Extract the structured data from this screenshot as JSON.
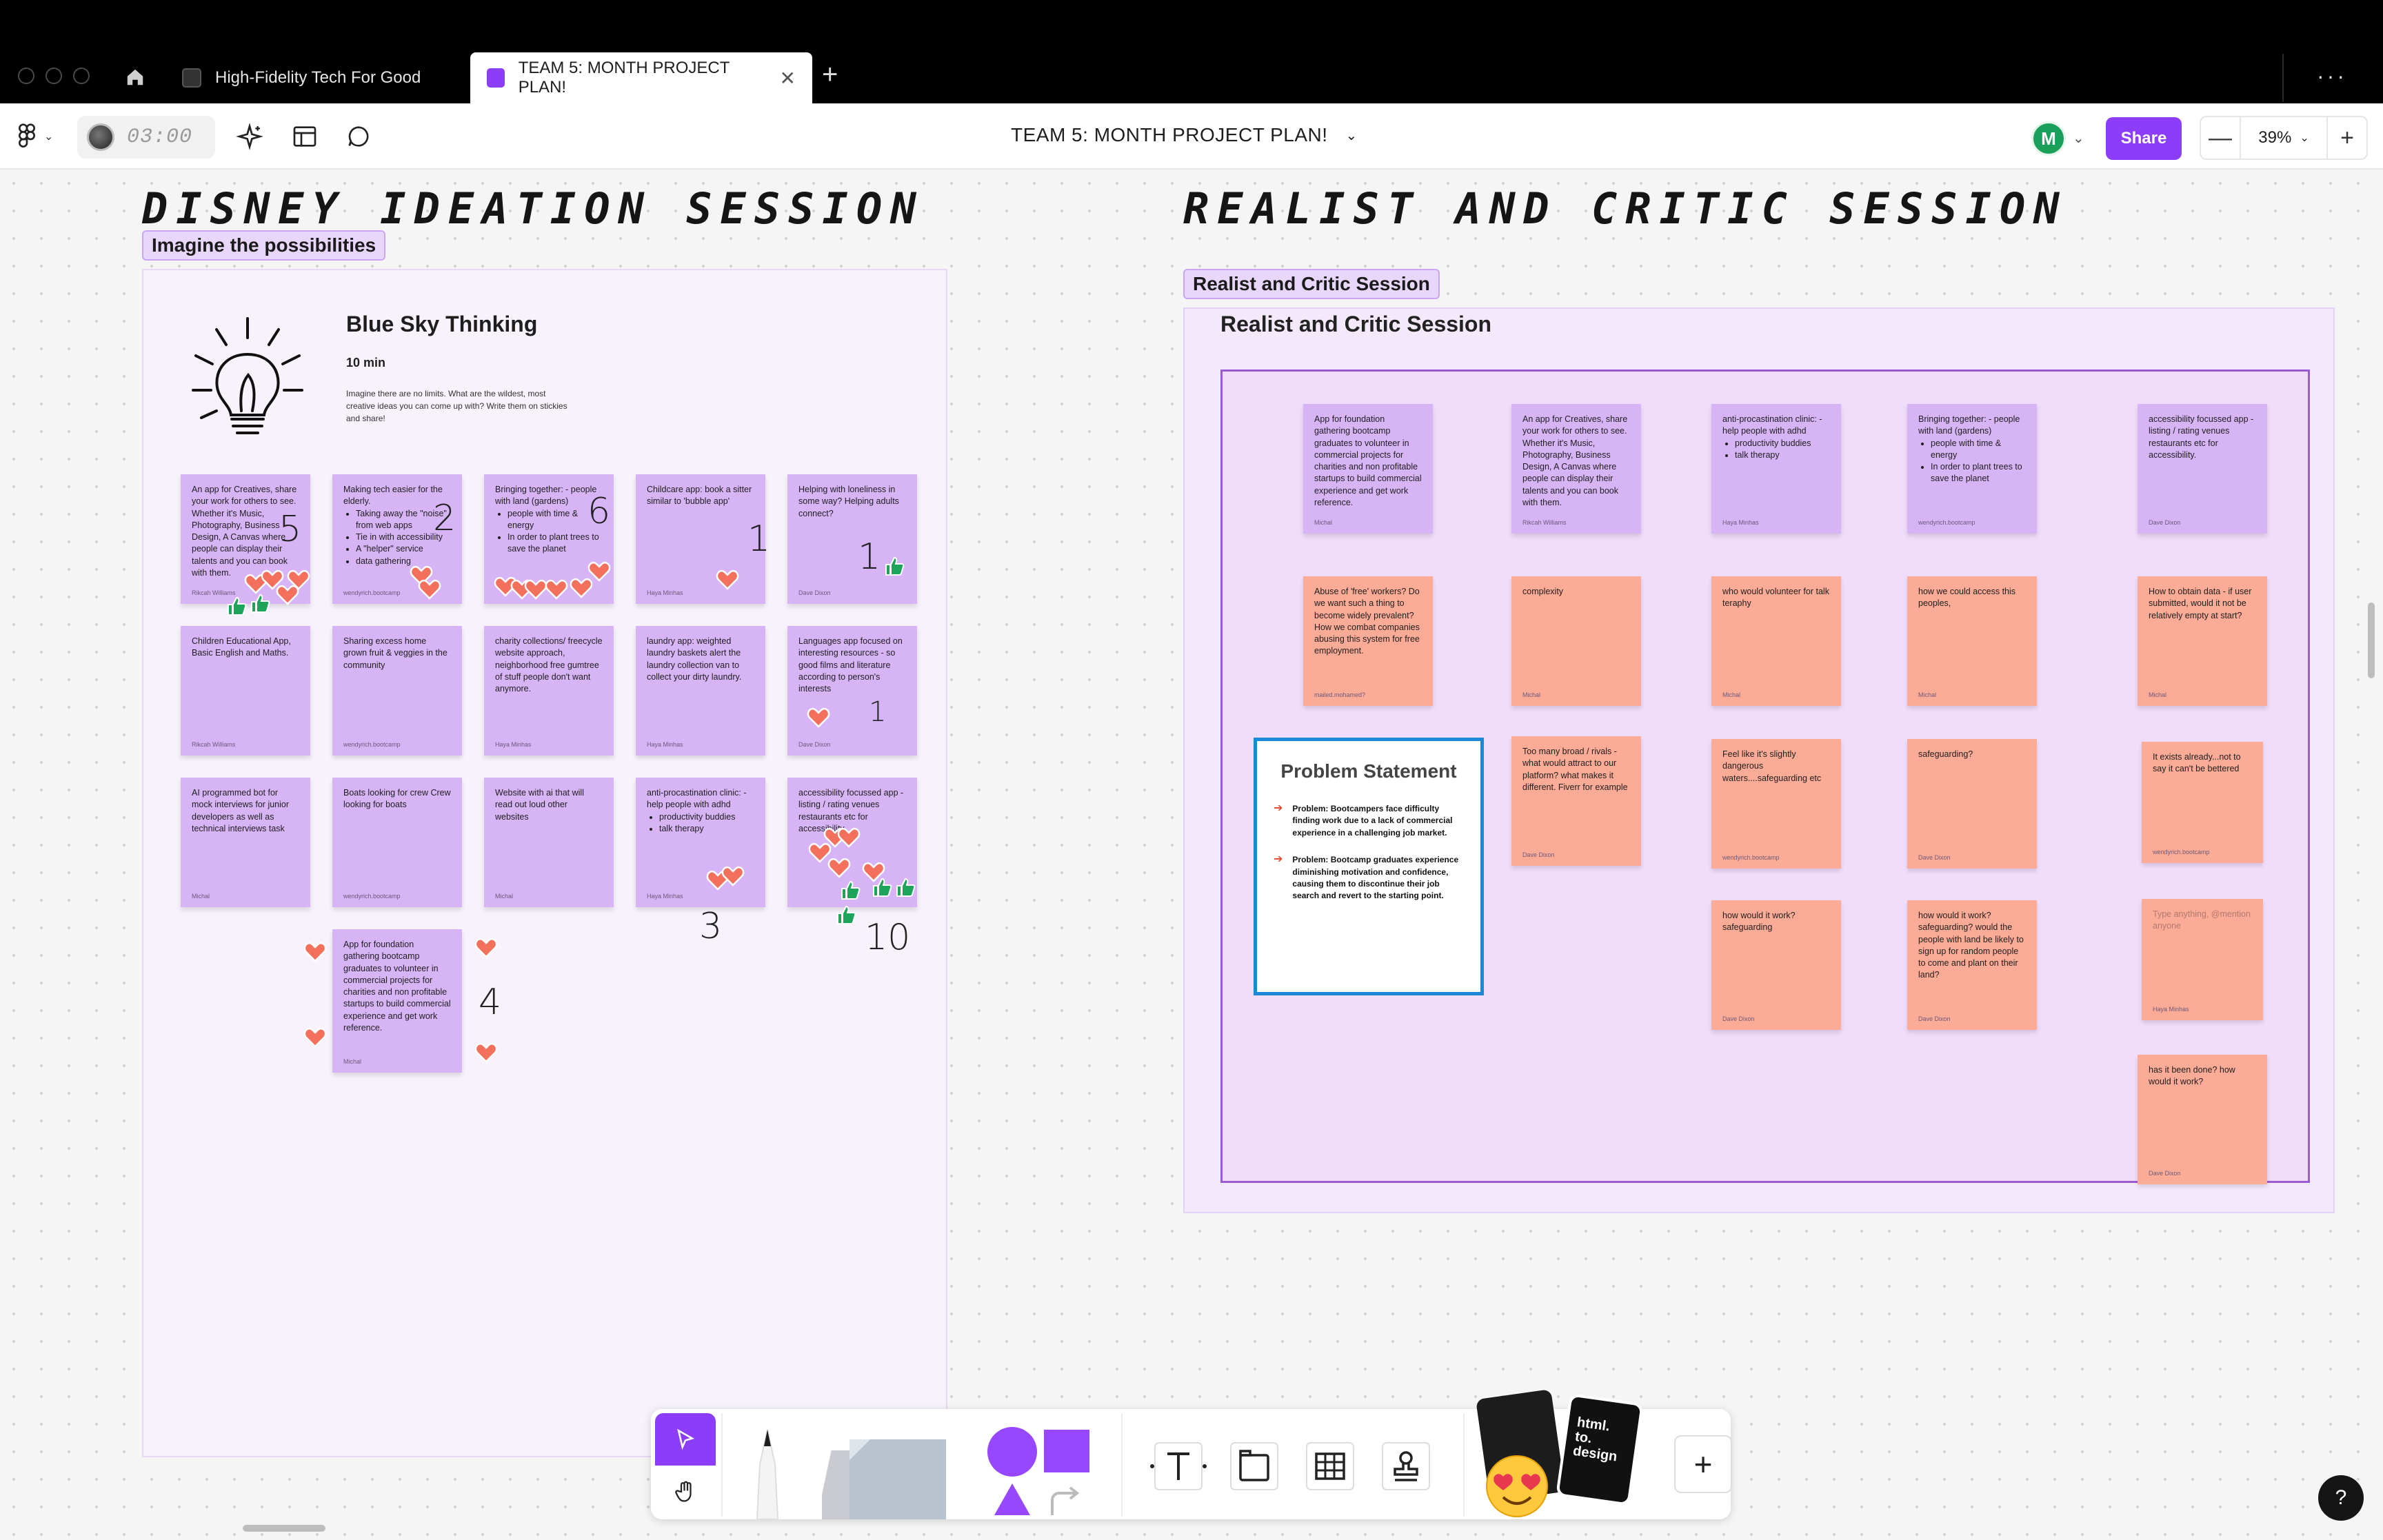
{
  "browser": {
    "tabs": [
      {
        "label": "High-Fidelity Tech For Good",
        "active": false
      },
      {
        "label": "TEAM 5: MONTH PROJECT PLAN!",
        "active": true
      }
    ],
    "new_tab_symbol": "+",
    "close_symbol": "✕",
    "more_symbol": "···"
  },
  "toolbar": {
    "timer": "03:00",
    "file_title": "TEAM 5: MONTH PROJECT PLAN!",
    "avatar_initial": "M",
    "share_label": "Share",
    "zoom": "39%",
    "zoom_minus": "—",
    "zoom_plus": "+"
  },
  "left_section": {
    "handwritten_title": "DISNEY IDEATION SESSION",
    "label": "Imagine the possibilities",
    "card_title": "Blue Sky Thinking",
    "card_time": "10 min",
    "card_desc": "Imagine there are no limits. What are the wildest, most creative ideas you can come up with? Write them on stickies and share!"
  },
  "right_section": {
    "handwritten_title": "REALIST AND CRITIC SESSION",
    "label": "Realist and Critic Session",
    "title": "Realist and Critic Session"
  },
  "left_stickies": [
    {
      "text": "An app for Creatives, share your work for others to see. Whether it's Music, Photography, Business Design, A Canvas where people can display their talents and you can book with them.",
      "author": "Rikcah Williams"
    },
    {
      "text": "Making tech easier for the elderly.",
      "bullets": [
        "Taking away the \"noise\" from web apps",
        "Tie in with accessibility",
        "A \"helper\" service",
        "data gathering"
      ],
      "author": "wendyrich.bootcamp"
    },
    {
      "text": "Bringing together: - people with land (gardens)",
      "bullets": [
        "people with time & energy",
        "In order to plant trees to save the planet"
      ],
      "author": ""
    },
    {
      "text": "Childcare app: book a sitter similar to 'bubble app'",
      "author": "Haya Minhas"
    },
    {
      "text": "Helping with loneliness in some way? Helping adults connect?",
      "author": "Dave Dixon"
    },
    {
      "text": "Children Educational App, Basic English and Maths.",
      "author": "Rikcah Williams"
    },
    {
      "text": "Sharing excess home grown fruit & veggies in the community",
      "author": "wendyrich.bootcamp"
    },
    {
      "text": "charity collections/ freecycle website approach, neighborhood free gumtree of stuff people don't want anymore.",
      "author": "Haya Minhas"
    },
    {
      "text": "laundry app: weighted laundry baskets alert the laundry collection van to collect your dirty laundry.",
      "author": "Haya Minhas"
    },
    {
      "text": "Languages app focused on interesting resources - so good films and literature according to person's interests",
      "author": "Dave Dixon"
    },
    {
      "text": "AI programmed bot for mock interviews for junior developers as well as technical interviews task",
      "author": "Michal"
    },
    {
      "text": "Boats looking for crew Crew looking for boats",
      "author": "wendyrich.bootcamp"
    },
    {
      "text": "Website with ai that will read out loud other websites",
      "author": "Michal"
    },
    {
      "text": "anti-procastination clinic: - help people with adhd",
      "bullets": [
        "productivity buddies",
        "talk therapy"
      ],
      "author": "Haya Minhas"
    },
    {
      "text": "accessibility focussed app - listing / rating venues restaurants etc for accessibility.",
      "author": "Dave Dixon"
    },
    {
      "text": "App for foundation gathering bootcamp graduates to volunteer in commercial projects for charities and non profitable startups to build commercial experience and get work reference.",
      "author": "Michal"
    }
  ],
  "tallies": [
    "5",
    "2",
    "6",
    "1",
    "1",
    "1",
    "3",
    "10",
    "4"
  ],
  "right_purple": [
    {
      "text": "App for foundation gathering bootcamp graduates to volunteer in commercial projects for charities and non profitable startups to build commercial experience and get work reference.",
      "author": "Michal"
    },
    {
      "text": "An app for Creatives, share your work for others to see. Whether it's Music, Photography, Business Design, A Canvas where people can display their talents and you can book with them.",
      "author": "Rikcah Williams"
    },
    {
      "text": "anti-procastination clinic: - help people with adhd",
      "bullets": [
        "productivity buddies",
        "talk therapy"
      ],
      "author": "Haya Minhas"
    },
    {
      "text": "Bringing together: - people with land (gardens)",
      "bullets": [
        "people with time & energy",
        "In order to plant trees to save the planet"
      ],
      "author": "wendyrich.bootcamp"
    },
    {
      "text": "accessibility focussed app - listing / rating venues restaurants etc for accessibility.",
      "author": "Dave Dixon"
    }
  ],
  "right_salmon": [
    {
      "text": "Abuse of 'free' workers? Do we want such a thing to become widely prevalent? How we combat companies abusing this system for free employment.",
      "author": "mailed.mohamed?"
    },
    {
      "text": "complexity",
      "author": "Michal"
    },
    {
      "text": "who would volunteer for talk teraphy",
      "author": "Michal"
    },
    {
      "text": "how we could access this peoples,",
      "author": "Michal"
    },
    {
      "text": "How to obtain data - if user submitted, would it not be relatively empty at start?",
      "author": "Michal"
    },
    {
      "text": "Too many broad / rivals - what would attract to our platform? what makes it different. Fiverr for example",
      "author": "Dave Dixon"
    },
    {
      "text": "Feel like it's slightly dangerous waters....safeguarding etc",
      "author": "wendyrich.bootcamp"
    },
    {
      "text": "safeguarding?",
      "author": "Dave Dixon"
    },
    {
      "text": "It exists already...not to say it can't be bettered",
      "author": "wendyrich.bootcamp"
    },
    {
      "text": "how would it work? safeguarding",
      "author": "Dave Dixon"
    },
    {
      "text": "how would it work? safeguarding? would the people with land be likely to sign up for random people to come and plant on their land?",
      "author": "Dave Dixon"
    },
    {
      "text": "Type anything, @mention anyone",
      "author": "Haya Minhas"
    },
    {
      "text": "has it been done? how would it work?",
      "author": "Dave Dixon"
    }
  ],
  "problem_statement": {
    "title": "Problem Statement",
    "items": [
      "Problem: Bootcampers face difficulty finding work due to a lack of commercial experience in a challenging job market.",
      "Problem: Bootcamp graduates experience diminishing motivation and confidence, causing them to discontinue their job search and revert to the starting point."
    ]
  },
  "dock": {
    "sticker_text": "html. to. design",
    "help_symbol": "?"
  },
  "colors": {
    "accent": "#8c3df7",
    "sticky_purple": "#d7b4f6",
    "sticky_salmon": "#fbab96",
    "heart": "#f2705c",
    "thumb": "#1ea35b",
    "problem_border": "#1e88d8"
  }
}
